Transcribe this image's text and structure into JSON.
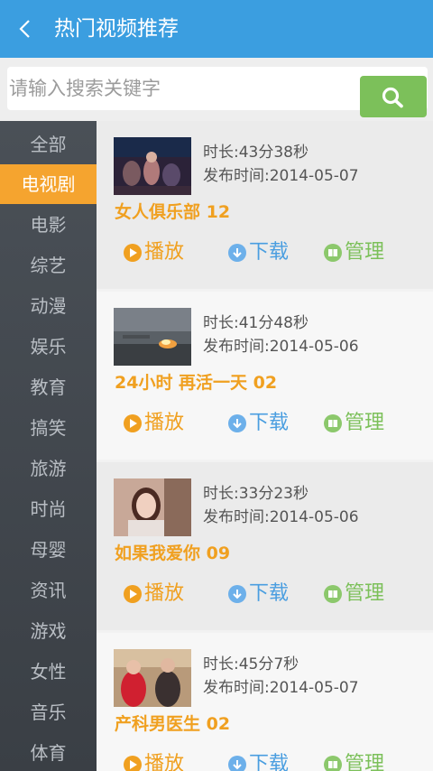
{
  "header": {
    "title": "热门视频推荐"
  },
  "search": {
    "placeholder": "请输入搜索关键字"
  },
  "sidebar": {
    "items": [
      {
        "label": "全部"
      },
      {
        "label": "电视剧",
        "active": true
      },
      {
        "label": "电影"
      },
      {
        "label": "综艺"
      },
      {
        "label": "动漫"
      },
      {
        "label": "娱乐"
      },
      {
        "label": "教育"
      },
      {
        "label": "搞笑"
      },
      {
        "label": "旅游"
      },
      {
        "label": "时尚"
      },
      {
        "label": "母婴"
      },
      {
        "label": "资讯"
      },
      {
        "label": "游戏"
      },
      {
        "label": "女性"
      },
      {
        "label": "音乐"
      },
      {
        "label": "体育"
      }
    ]
  },
  "videos": [
    {
      "duration": "时长:43分38秒",
      "published": "发布时间:2014-05-07",
      "title": "女人俱乐部 12",
      "play": "播放",
      "download": "下载",
      "manage": "管理"
    },
    {
      "duration": "时长:41分48秒",
      "published": "发布时间:2014-05-06",
      "title": "24小时 再活一天 02",
      "play": "播放",
      "download": "下载",
      "manage": "管理"
    },
    {
      "duration": "时长:33分23秒",
      "published": "发布时间:2014-05-06",
      "title": "如果我爱你 09",
      "play": "播放",
      "download": "下载",
      "manage": "管理"
    },
    {
      "duration": "时长:45分7秒",
      "published": "发布时间:2014-05-07",
      "title": "产科男医生 02",
      "play": "播放",
      "download": "下载",
      "manage": "管理"
    }
  ],
  "colors": {
    "header": "#3b9ee0",
    "accent": "#f0a020",
    "download": "#4a9ee0",
    "manage": "#7cc05a"
  }
}
